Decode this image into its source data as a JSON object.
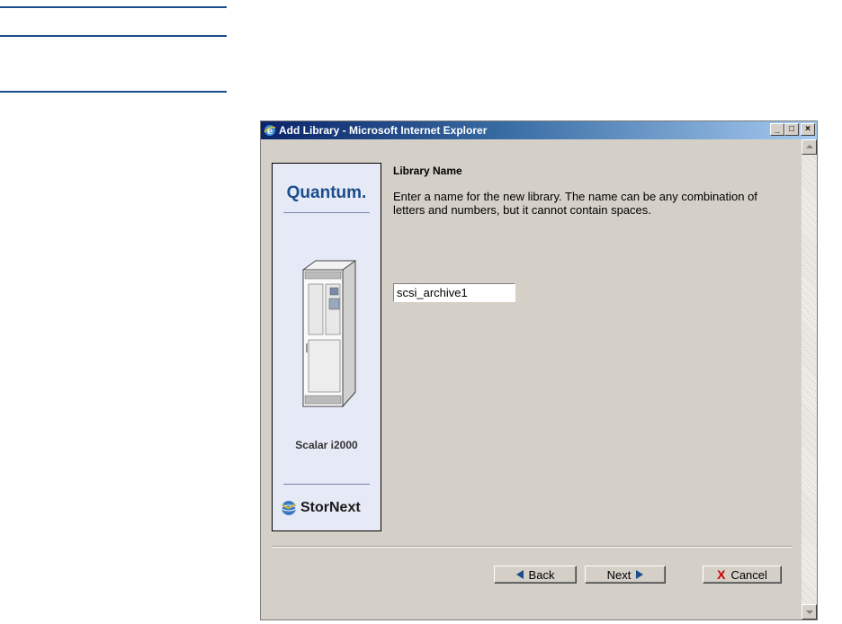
{
  "window": {
    "title": "Add Library - Microsoft Internet Explorer",
    "minimize": "_",
    "maximize": "□",
    "close": "×"
  },
  "banner": {
    "brand": "Quantum.",
    "product": "Scalar i2000",
    "footer_brand": "StorNext"
  },
  "form": {
    "heading": "Library Name",
    "description": "Enter a name for the new library. The name can be any combination of letters and numbers, but it cannot contain spaces.",
    "library_name_value": "scsi_archive1"
  },
  "buttons": {
    "back": "Back",
    "next": "Next",
    "cancel": "Cancel"
  },
  "icons": {
    "window_icon": "ie-icon",
    "back_icon": "arrow-left-icon",
    "next_icon": "arrow-right-icon",
    "cancel_icon": "x-icon"
  },
  "colors": {
    "accent": "#1a4e8c",
    "titlebar_start": "#0a246a",
    "titlebar_end": "#a6caf0",
    "cancel_x": "#cc0000"
  }
}
